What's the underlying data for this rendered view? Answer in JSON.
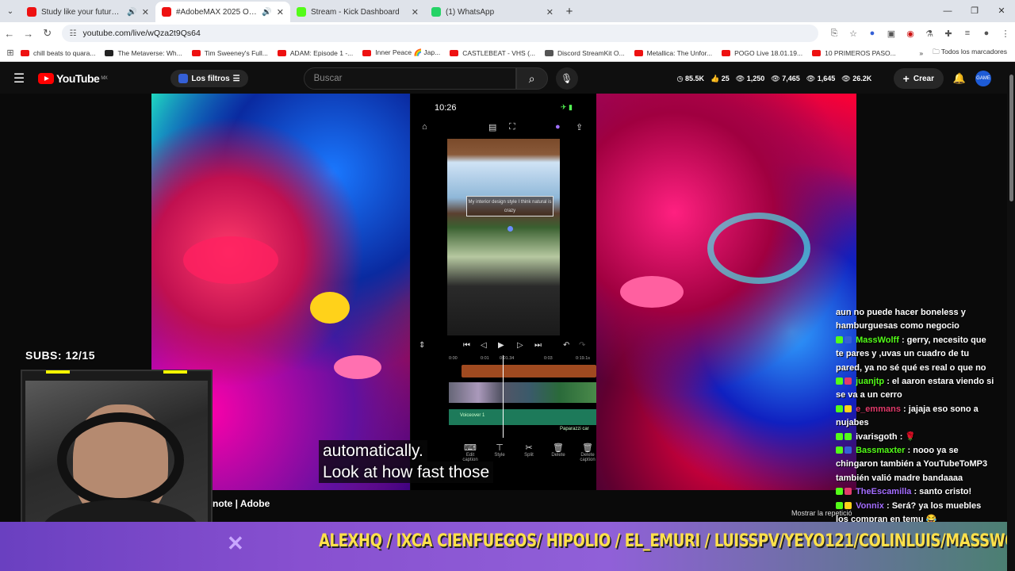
{
  "browser": {
    "tabs": [
      {
        "title": "Study like your future depe",
        "color": "#e11",
        "active": false
      },
      {
        "title": "#AdobeMAX 2025 Opening",
        "color": "#e11",
        "active": true
      },
      {
        "title": "Stream - Kick Dashboard",
        "color": "#53fc18",
        "active": false
      },
      {
        "title": "(1) WhatsApp",
        "color": "#25d366",
        "active": false
      }
    ],
    "url": "youtube.com/live/wQza2t9Qs64",
    "bookmarks": [
      "chill beats to quara...",
      "The Metaverse: Wh...",
      "Tim Sweeney's Full...",
      "ADAM: Episode 1 -...",
      "Inner Peace 🌈 Jap...",
      "CASTLEBEAT - VHS (...",
      "Discord StreamKit O...",
      "Metallica: The Unfor...",
      "POGO Live 18.01.19...",
      "10 PRIMEROS PASO..."
    ],
    "bookmarks_more": "»",
    "all_bookmarks": "Todos los marcadores"
  },
  "youtube": {
    "logo": "YouTube",
    "region": "MX",
    "filters_label": "Los filtros",
    "search_placeholder": "Buscar",
    "stats": [
      "85.5K",
      "25",
      "1,250",
      "7,465",
      "1,645",
      "26.2K"
    ],
    "create_label": "Crear",
    "avatar_text": "GAME"
  },
  "stream": {
    "subs_goal": "SUBS: 12/15",
    "caption_lines": [
      "automatically.",
      "Look at how fast those"
    ],
    "video_title_fragment": "note | Adobe",
    "replay_label": "Mostrar la repetició",
    "phone": {
      "time": "10:26",
      "caption_box": "My interior design style I think natural is crazy",
      "ruler": [
        "0:00",
        "0:01",
        "0:01.34",
        "0:03",
        "0:19.1s"
      ],
      "audio_label": "Voiceover 1",
      "audio_label_right": "Paparazzi car",
      "tools": [
        {
          "icon": "⌨",
          "label": "Edit caption"
        },
        {
          "icon": "⊤",
          "label": "Style"
        },
        {
          "icon": "✂",
          "label": "Split"
        },
        {
          "icon": "🗑",
          "label": "Delete"
        },
        {
          "icon": "🗑",
          "label": "Delete caption"
        }
      ]
    },
    "chat": [
      {
        "user": "",
        "color": "#fff",
        "text": "aun no puede hacer boneless y hamburguesas como negocio"
      },
      {
        "user": "MassWolff",
        "color": "#53fc18",
        "text": ": gerry, necesito que te pares y ,uvas un cuadro de tu pared, ya no sé qué es real o que no"
      },
      {
        "user": "juanjtp",
        "color": "#53fc18",
        "text": ": el aaron estara viendo si se va a un cerro"
      },
      {
        "user": "e_emmans",
        "color": "#e23a6a",
        "text": ": jajaja eso sono a nujabes"
      },
      {
        "user": "ivarisgoth",
        "color": "#fff",
        "text": ": 🌹"
      },
      {
        "user": "Bassmaxter",
        "color": "#53fc18",
        "text": ": nooo ya se chingaron también a YouTubeToMP3 también valió madre bandaaaa"
      },
      {
        "user": "TheEscamilla",
        "color": "#a36cff",
        "text": ": santo cristo!"
      },
      {
        "user": "Vonnix",
        "color": "#a36cff",
        "text": ": Será? ya los muebles los compran en temu 😂"
      }
    ],
    "ticker_x": "✕",
    "ticker_names": "ALEXHQ / IXCA CIENFUEGOS/ HIPOLIO / EL_EMURI / LUISSPV/YEYO121/COLINLUIS/MASSWOLFF"
  }
}
